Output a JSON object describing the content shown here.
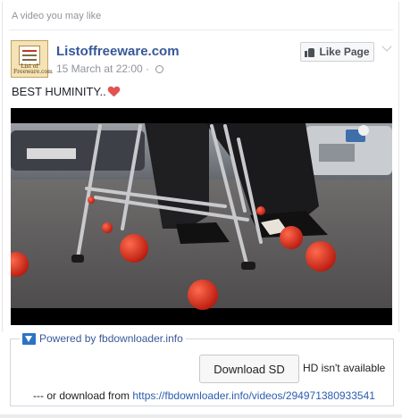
{
  "card": {
    "header": "A video you may like"
  },
  "post": {
    "page_name": "Listoffreeware.com",
    "logo_text": "List of Freeware.com",
    "timestamp": "15 March at 22:00 ·",
    "text": "BEST HUMINITY..",
    "like_button": "Like Page"
  },
  "downloader": {
    "title": "Powered by fbdownloader.info",
    "download_sd": "Download SD",
    "hd_note": "HD isn't available",
    "or_text": "--- or download from ",
    "link": "https://fbdownloader.info/videos/294971380933541"
  },
  "colors": {
    "link": "#365899",
    "accent_blue": "#2a74c7",
    "heart": "#e05353"
  },
  "icons": [
    "thumbs-up-icon",
    "globe-icon",
    "heart-icon",
    "chevron-down-icon",
    "download-arrow-icon"
  ]
}
